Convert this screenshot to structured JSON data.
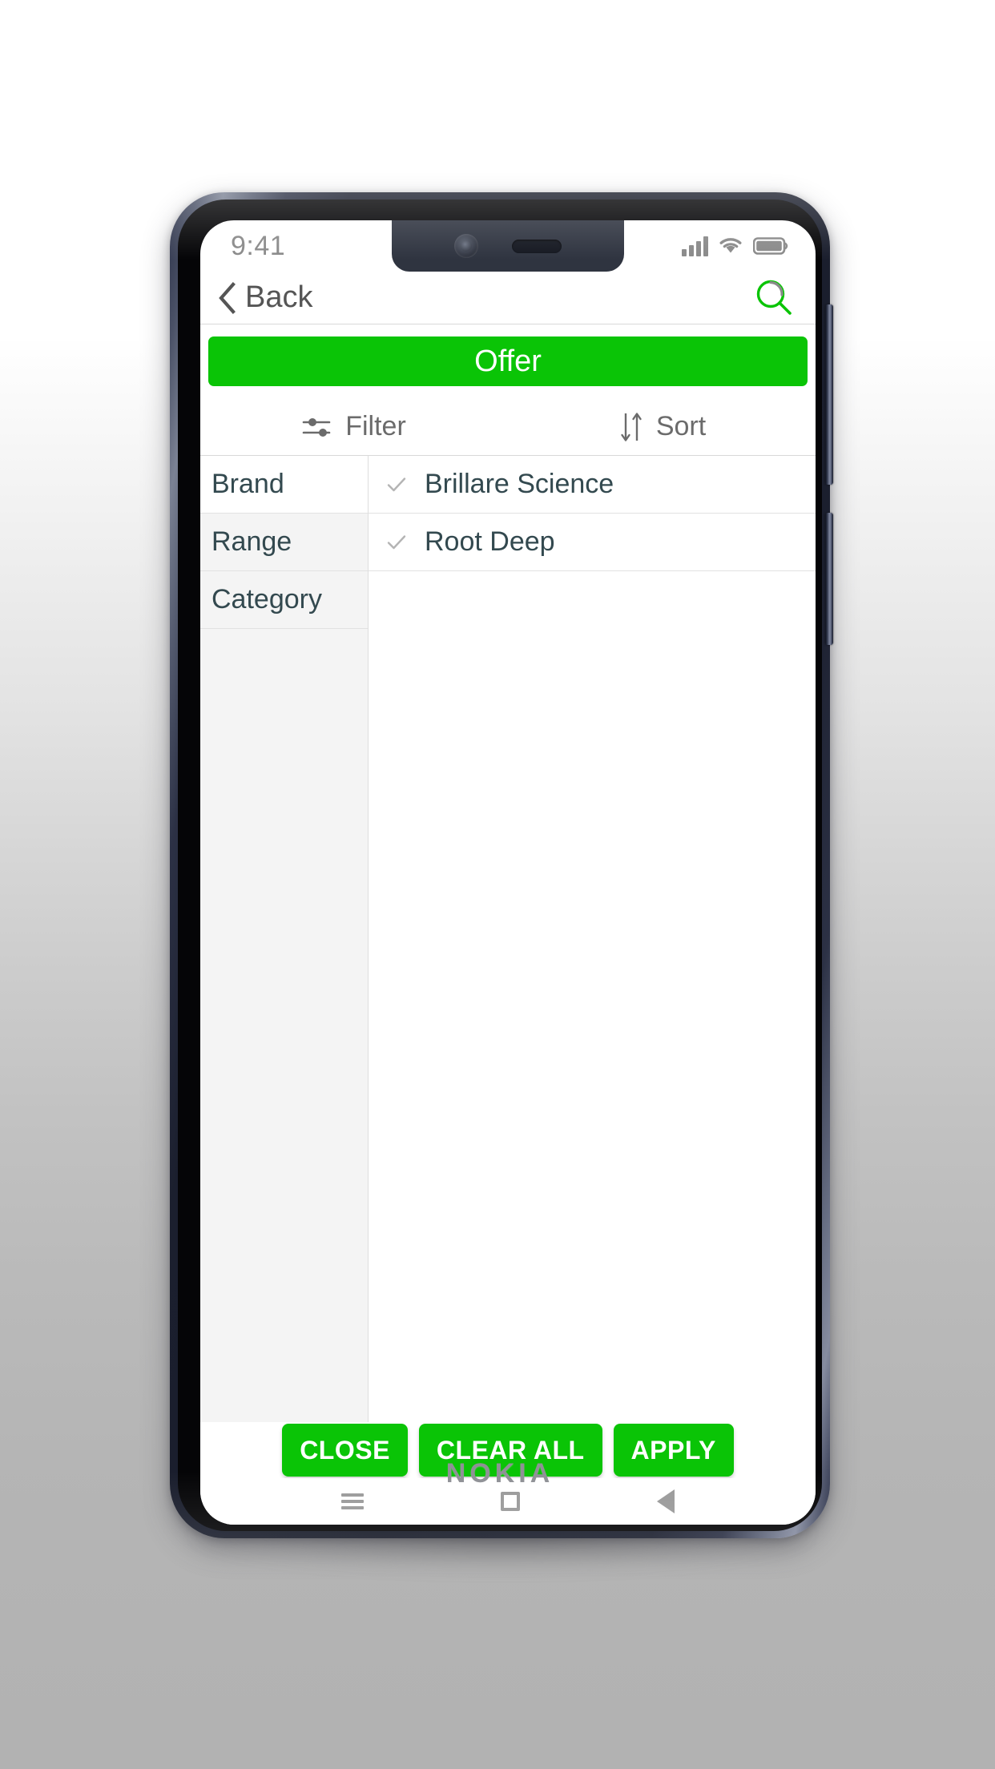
{
  "device": {
    "brand": "NOKIA",
    "icons": {
      "front_camera": "front-camera-icon",
      "earpiece": "earpiece-speaker",
      "volume_button": "volume-button",
      "power_button": "power-button"
    }
  },
  "status_bar": {
    "time": "9:41",
    "icons": {
      "signal": "signal-icon",
      "wifi": "wifi-icon",
      "battery": "battery-icon"
    }
  },
  "header": {
    "back_label": "Back",
    "back_icon": "chevron-left-icon",
    "search_icon": "search-icon"
  },
  "offer": {
    "label": "Offer"
  },
  "toolbar": {
    "filter_label": "Filter",
    "filter_icon": "filter-sliders-icon",
    "sort_label": "Sort",
    "sort_icon": "sort-arrows-icon"
  },
  "filter_panel": {
    "categories": [
      {
        "label": "Brand"
      },
      {
        "label": "Range"
      },
      {
        "label": "Category"
      }
    ],
    "options": [
      {
        "label": "Brillare Science",
        "checked": true
      },
      {
        "label": "Root Deep",
        "checked": true
      }
    ]
  },
  "footer": {
    "buttons": [
      {
        "label": "CLOSE"
      },
      {
        "label": "CLEAR ALL"
      },
      {
        "label": "APPLY"
      }
    ]
  },
  "android_nav": {
    "menu_icon": "menu-icon",
    "home_icon": "home-square-icon",
    "back_icon": "back-triangle-icon"
  },
  "colors": {
    "accent_green": "#0ac406",
    "text_slate": "#33494f",
    "text_gray": "#6b6b6b",
    "panel_gray": "#f4f4f4"
  }
}
